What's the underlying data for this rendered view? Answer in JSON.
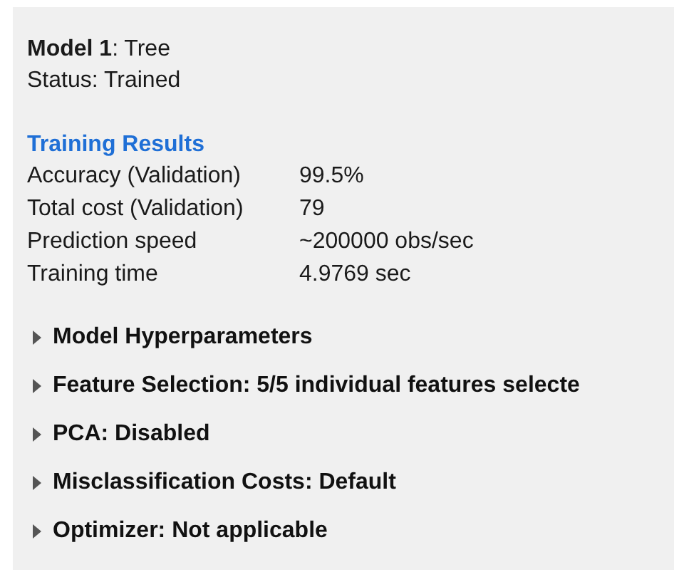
{
  "model": {
    "title": "**Model 1**: Tree",
    "status": "Status: Trained"
  },
  "training_results": {
    "heading": "Training Results",
    "rows": [
      {
        "label": "Accuracy (Validation)",
        "value": "99.5%"
      },
      {
        "label": "Total cost (Validation)",
        "value": "79"
      },
      {
        "label": "Prediction speed",
        "value": "~200000 obs/sec"
      },
      {
        "label": "Training time",
        "value": "4.9769 sec"
      }
    ]
  },
  "sections": [
    {
      "label": "Model Hyperparameters",
      "expanded": false
    },
    {
      "label": "Feature Selection: 5/5 individual features selecte",
      "expanded": false
    },
    {
      "label": "PCA: Disabled",
      "expanded": false
    },
    {
      "label": "Misclassification Costs: Default",
      "expanded": false
    },
    {
      "label": "Optimizer: Not applicable",
      "expanded": false
    }
  ]
}
